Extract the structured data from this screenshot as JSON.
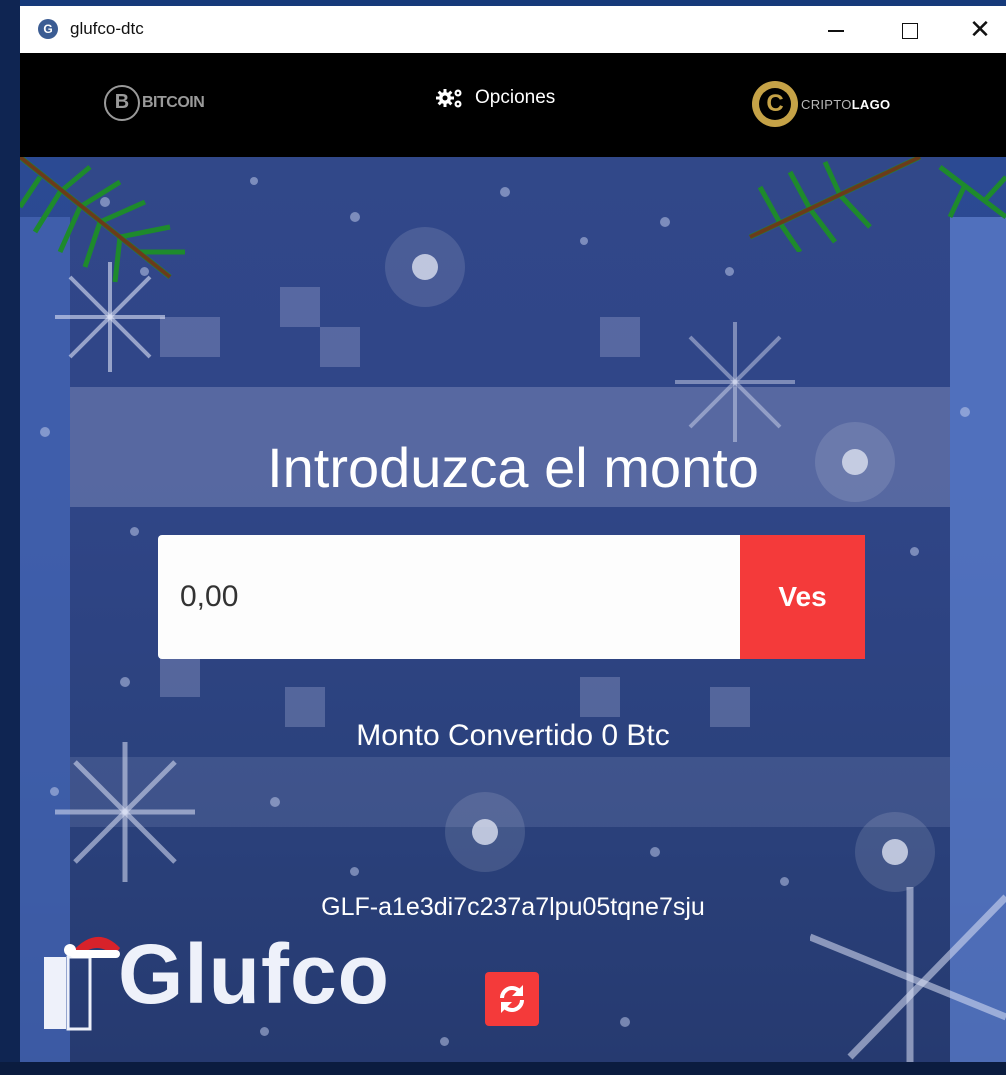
{
  "window": {
    "title": "glufco-dtc",
    "app_icon_letter": "G"
  },
  "nav": {
    "bitcoin_label": "BITCOIN",
    "bitcoin_symbol": "B",
    "options_label": "Opciones",
    "criptolago_prefix": "CRIPTO",
    "criptolago_suffix": "LAGO",
    "criptolago_symbol": "C"
  },
  "main": {
    "heading": "Introduzca el monto",
    "amount_value": "0,00",
    "currency_button": "Ves",
    "converted_text": "Monto Convertido 0 Btc",
    "code": "GLF-a1e3di7c237a7lpu05tqne7sju",
    "logo_text": "Glufco"
  },
  "colors": {
    "accent_red": "#f43a3a",
    "gold": "#c5a247",
    "navbar_bg": "#000000",
    "scene_bg": "#2a4690"
  }
}
